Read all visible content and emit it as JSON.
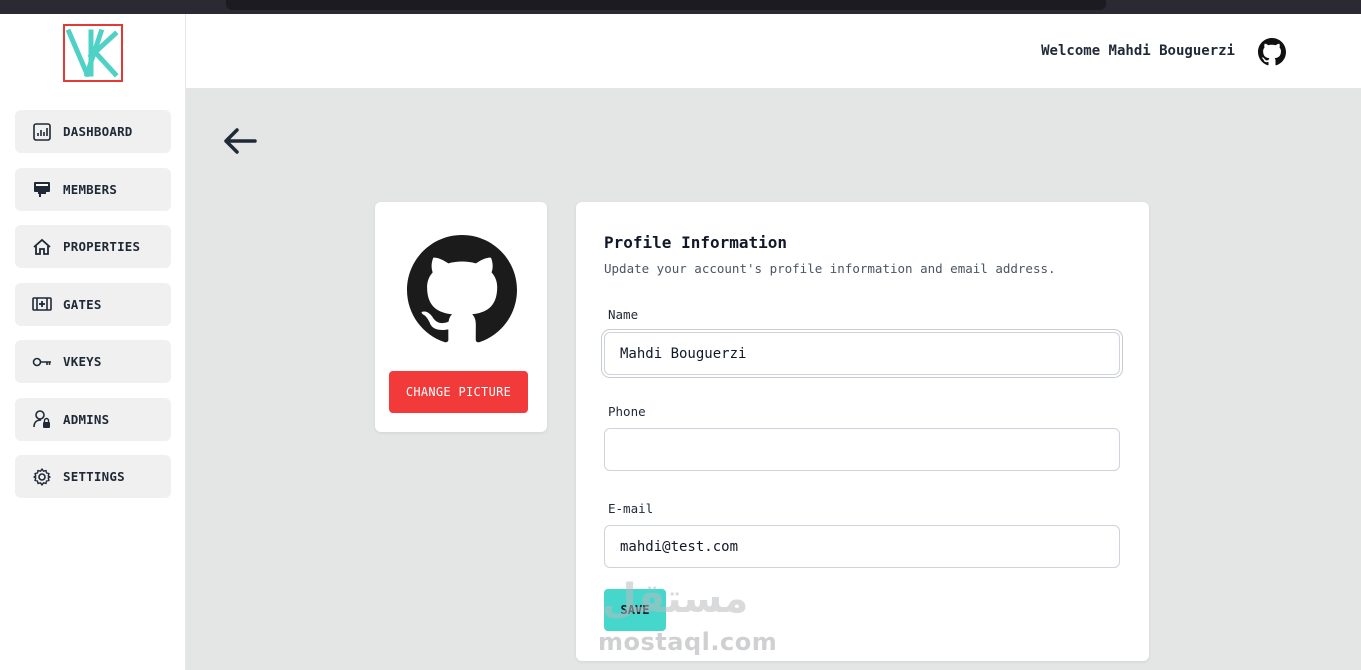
{
  "header": {
    "welcome_text": "Welcome Mahdi Bouguerzi"
  },
  "sidebar": {
    "items": [
      {
        "label": "DASHBOARD",
        "icon": "dashboard-chart-icon"
      },
      {
        "label": "MEMBERS",
        "icon": "members-icon"
      },
      {
        "label": "PROPERTIES",
        "icon": "home-icon"
      },
      {
        "label": "GATES",
        "icon": "gate-icon"
      },
      {
        "label": "VKEYS",
        "icon": "key-icon"
      },
      {
        "label": "ADMINS",
        "icon": "admin-lock-icon"
      },
      {
        "label": "SETTINGS",
        "icon": "gear-icon"
      }
    ]
  },
  "picture_card": {
    "change_label": "CHANGE PICTURE"
  },
  "profile": {
    "title": "Profile Information",
    "subtitle": "Update your account's profile information and email address.",
    "name_label": "Name",
    "name_value": "Mahdi Bouguerzi",
    "phone_label": "Phone",
    "phone_value": "",
    "email_label": "E-mail",
    "email_value": "mahdi@test.com",
    "save_label": "SAVE"
  },
  "watermark": {
    "arabic": "مستقل",
    "latin": "mostaql.com"
  },
  "colors": {
    "accent": "#45d6cc",
    "danger": "#f23a3a",
    "logo_teal": "#4fd1c5",
    "logo_border": "#e53935"
  }
}
